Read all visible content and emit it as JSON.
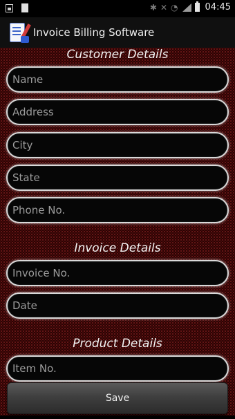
{
  "status_bar": {
    "time": "04:45",
    "icons": [
      "image-icon",
      "block-icon",
      "bluetooth-icon",
      "mute-icon",
      "wifi-icon",
      "signal-icon",
      "battery-icon"
    ]
  },
  "app": {
    "title": "Invoice Billing Software",
    "icon": "invoice-app-icon"
  },
  "sections": {
    "customer": "Customer Details",
    "invoice": "Invoice Details",
    "product": "Product Details"
  },
  "fields": {
    "name": {
      "placeholder": "Name",
      "value": ""
    },
    "address": {
      "placeholder": "Address",
      "value": ""
    },
    "city": {
      "placeholder": "City",
      "value": ""
    },
    "state": {
      "placeholder": "State",
      "value": ""
    },
    "phone": {
      "placeholder": "Phone No.",
      "value": ""
    },
    "invoice_no": {
      "placeholder": "Invoice No.",
      "value": ""
    },
    "date": {
      "placeholder": "Date",
      "value": ""
    },
    "item_no": {
      "placeholder": "Item No.",
      "value": ""
    }
  },
  "actions": {
    "save_label": "Save"
  },
  "colors": {
    "background": "#2a0404",
    "field_border": "#d9d9d9",
    "text": "#f2f2f2"
  }
}
